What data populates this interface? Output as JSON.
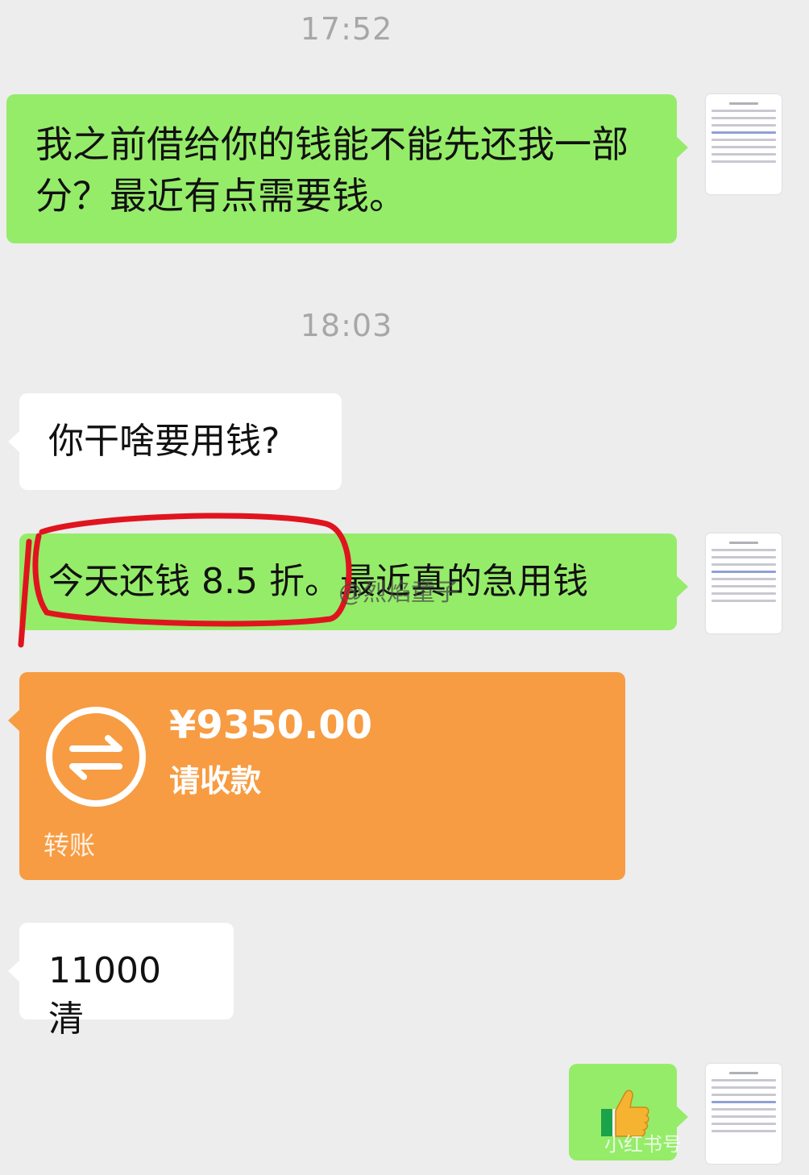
{
  "timestamps": [
    "17:52",
    "18:03"
  ],
  "messages": {
    "m1": "我之前借给你的钱能不能先还我一部分？最近有点需要钱。",
    "m2": "你干啥要用钱?",
    "m3": "今天还钱 8.5 折。最近真的急用钱",
    "m5": "11000 清"
  },
  "transfer": {
    "amount": "¥9350.00",
    "status": "请收款",
    "label": "转账",
    "icon": "transfer-arrows-icon"
  },
  "sticker": {
    "icon": "thumbs-up-icon"
  },
  "watermarks": {
    "weibo": "@烈焰童子",
    "xiaohongshu": "小红书号"
  },
  "colors": {
    "background": "#ededed",
    "sent_bubble": "#95ec69",
    "received_bubble": "#ffffff",
    "transfer_card": "#f79c42",
    "annotation": "#e0141e"
  }
}
